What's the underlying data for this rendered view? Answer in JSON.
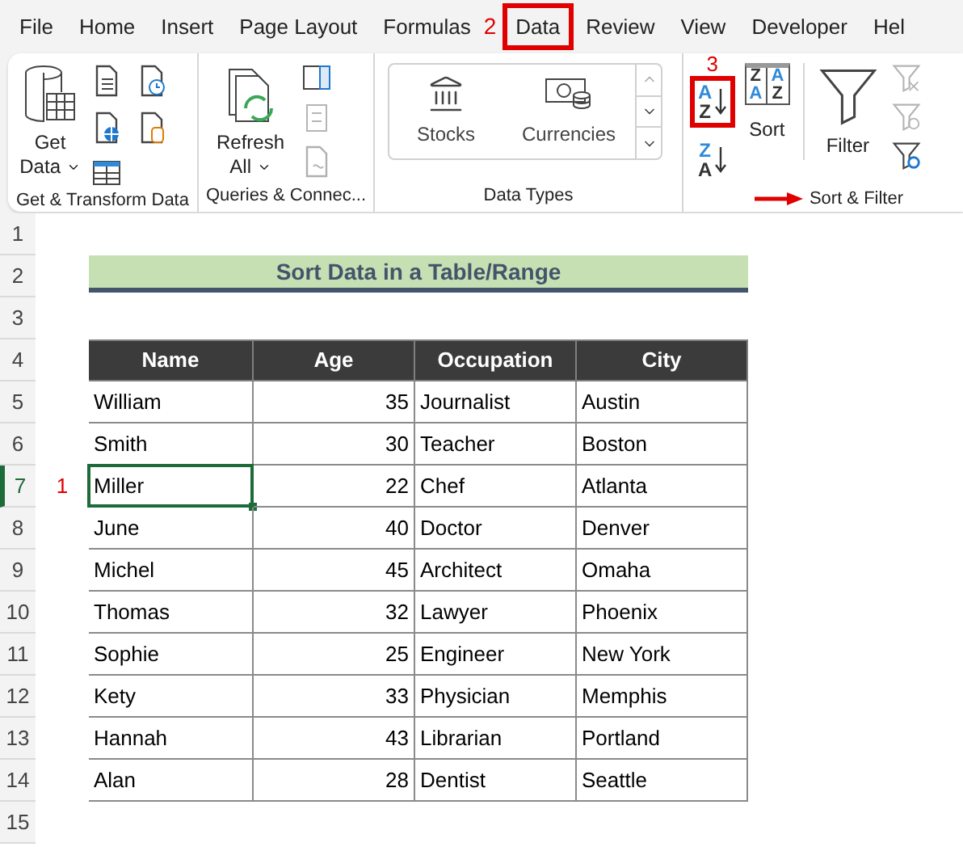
{
  "menu": {
    "tabs": [
      {
        "label": "File",
        "highlighted": false
      },
      {
        "label": "Home",
        "highlighted": false
      },
      {
        "label": "Insert",
        "highlighted": false
      },
      {
        "label": "Page Layout",
        "highlighted": false
      },
      {
        "label": "Formulas",
        "highlighted": false
      },
      {
        "label": "Data",
        "highlighted": true,
        "step": "2"
      },
      {
        "label": "Review",
        "highlighted": false
      },
      {
        "label": "View",
        "highlighted": false
      },
      {
        "label": "Developer",
        "highlighted": false
      },
      {
        "label": "Hel",
        "highlighted": false
      }
    ]
  },
  "ribbon": {
    "groups": [
      {
        "kind": "get_transform",
        "label": "Get & Transform Data",
        "button": "Get Data"
      },
      {
        "kind": "queries",
        "label": "Queries & Connec...",
        "button": "Refresh All"
      },
      {
        "kind": "data_types",
        "label": "Data Types",
        "items": [
          "Stocks",
          "Currencies"
        ]
      },
      {
        "kind": "sort_filter",
        "label": "Sort & Filter",
        "step": "3",
        "sort_ascending": {
          "letters": [
            "A",
            "Z"
          ],
          "highlighted": true
        },
        "sort_descending": {
          "letters": [
            "Z",
            "A"
          ],
          "highlighted": false
        },
        "sort": {
          "label": "Sort",
          "letters": [
            "Z",
            "A",
            "A",
            "Z"
          ]
        },
        "filter": {
          "label": "Filter"
        },
        "clear": {
          "disabled": true
        },
        "reapply": {
          "disabled": true
        }
      }
    ]
  },
  "sheet": {
    "row_headers": [
      {
        "label": "1",
        "selected": false
      },
      {
        "label": "2",
        "selected": false
      },
      {
        "label": "3",
        "selected": false
      },
      {
        "label": "4",
        "selected": false
      },
      {
        "label": "5",
        "selected": false
      },
      {
        "label": "6",
        "selected": false
      },
      {
        "label": "7",
        "selected": true,
        "step": "1"
      },
      {
        "label": "8",
        "selected": false
      },
      {
        "label": "9",
        "selected": false
      },
      {
        "label": "10",
        "selected": false
      },
      {
        "label": "11",
        "selected": false
      },
      {
        "label": "12",
        "selected": false
      },
      {
        "label": "13",
        "selected": false
      },
      {
        "label": "14",
        "selected": false
      },
      {
        "label": "15",
        "selected": false
      }
    ],
    "title": "Sort Data in a Table/Range",
    "table": {
      "columns": [
        "Name",
        "Age",
        "Occupation",
        "City"
      ],
      "rows": [
        {
          "cells": [
            {
              "text": "William",
              "selected": false
            },
            {
              "text": "35",
              "selected": false
            },
            {
              "text": "Journalist",
              "selected": false
            },
            {
              "text": "Austin",
              "selected": false
            }
          ]
        },
        {
          "cells": [
            {
              "text": "Smith",
              "selected": false
            },
            {
              "text": "30",
              "selected": false
            },
            {
              "text": "Teacher",
              "selected": false
            },
            {
              "text": "Boston",
              "selected": false
            }
          ]
        },
        {
          "cells": [
            {
              "text": "Miller",
              "selected": true
            },
            {
              "text": "22",
              "selected": false
            },
            {
              "text": "Chef",
              "selected": false
            },
            {
              "text": "Atlanta",
              "selected": false
            }
          ]
        },
        {
          "cells": [
            {
              "text": "June",
              "selected": false
            },
            {
              "text": "40",
              "selected": false
            },
            {
              "text": "Doctor",
              "selected": false
            },
            {
              "text": "Denver",
              "selected": false
            }
          ]
        },
        {
          "cells": [
            {
              "text": "Michel",
              "selected": false
            },
            {
              "text": "45",
              "selected": false
            },
            {
              "text": "Architect",
              "selected": false
            },
            {
              "text": "Omaha",
              "selected": false
            }
          ]
        },
        {
          "cells": [
            {
              "text": "Thomas",
              "selected": false
            },
            {
              "text": "32",
              "selected": false
            },
            {
              "text": "Lawyer",
              "selected": false
            },
            {
              "text": "Phoenix",
              "selected": false
            }
          ]
        },
        {
          "cells": [
            {
              "text": "Sophie",
              "selected": false
            },
            {
              "text": "25",
              "selected": false
            },
            {
              "text": "Engineer",
              "selected": false
            },
            {
              "text": "New York",
              "selected": false
            }
          ]
        },
        {
          "cells": [
            {
              "text": "Kety",
              "selected": false
            },
            {
              "text": "33",
              "selected": false
            },
            {
              "text": "Physician",
              "selected": false
            },
            {
              "text": "Memphis",
              "selected": false
            }
          ]
        },
        {
          "cells": [
            {
              "text": "Hannah",
              "selected": false
            },
            {
              "text": "43",
              "selected": false
            },
            {
              "text": "Librarian",
              "selected": false
            },
            {
              "text": "Portland",
              "selected": false
            }
          ]
        },
        {
          "cells": [
            {
              "text": "Alan",
              "selected": false
            },
            {
              "text": "28",
              "selected": false
            },
            {
              "text": "Dentist",
              "selected": false
            },
            {
              "text": "Seattle",
              "selected": false
            }
          ]
        }
      ]
    }
  }
}
